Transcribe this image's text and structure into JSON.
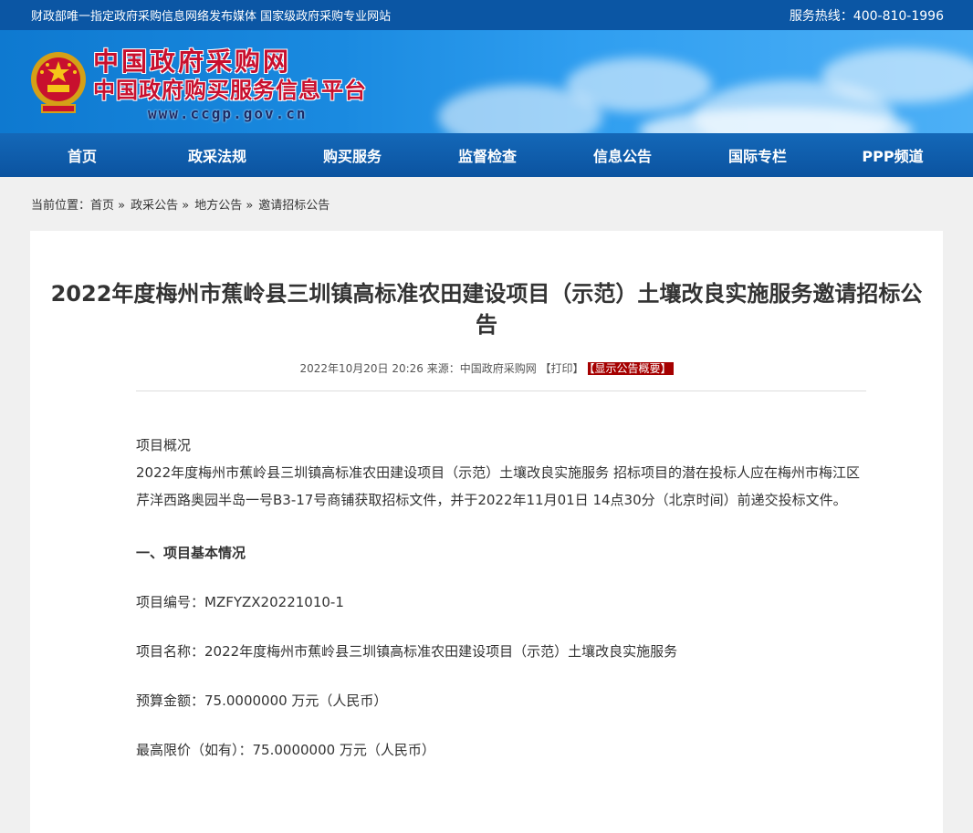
{
  "topbar": {
    "left": "财政部唯一指定政府采购信息网络发布媒体 国家级政府采购专业网站",
    "hotline": "服务热线：400-810-1996"
  },
  "banner": {
    "title1": "中国政府采购网",
    "title2": "中国政府购买服务信息平台",
    "url": "www.ccgp.gov.cn"
  },
  "nav": [
    "首页",
    "政采法规",
    "购买服务",
    "监督检查",
    "信息公告",
    "国际专栏",
    "PPP频道"
  ],
  "breadcrumb": {
    "prefix": "当前位置：",
    "items": [
      "首页 »",
      "政采公告 »",
      "地方公告 »",
      "邀请招标公告"
    ]
  },
  "article": {
    "title": "2022年度梅州市蕉岭县三圳镇高标准农田建设项目（示范）土壤改良实施服务邀请招标公告",
    "meta_text": "2022年10月20日 20:26 来源：中国政府采购网 【打印】",
    "meta_badge": "【显示公告概要】",
    "overview_label": "项目概况",
    "overview_text": "2022年度梅州市蕉岭县三圳镇高标准农田建设项目（示范）土壤改良实施服务 招标项目的潜在投标人应在梅州市梅江区芹洋西路奥园半岛一号B3-17号商铺获取招标文件，并于2022年11月01日 14点30分（北京时间）前递交投标文件。",
    "section1": "一、项目基本情况",
    "project_no": "项目编号：MZFYZX20221010-1",
    "project_name": "项目名称：2022年度梅州市蕉岭县三圳镇高标准农田建设项目（示范）土壤改良实施服务",
    "budget": "预算金额：75.0000000 万元（人民币）",
    "max_price": "最高限价（如有）：75.0000000 万元（人民币）"
  }
}
